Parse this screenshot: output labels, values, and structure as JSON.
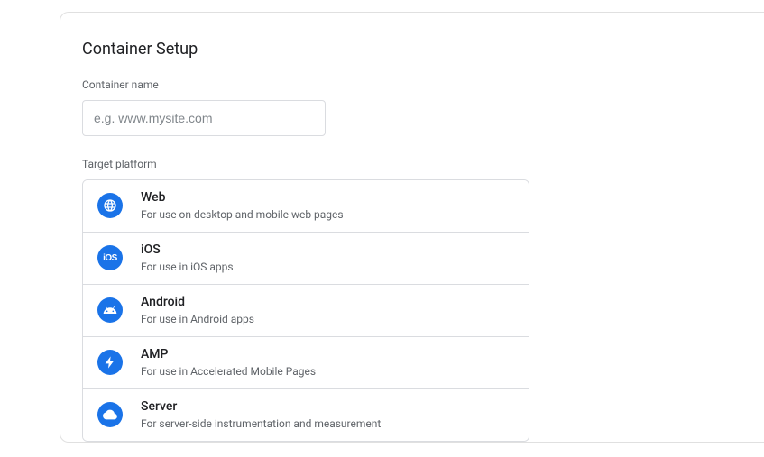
{
  "title": "Container Setup",
  "containerName": {
    "label": "Container name",
    "placeholder": "e.g. www.mysite.com",
    "value": ""
  },
  "targetPlatform": {
    "label": "Target platform",
    "options": [
      {
        "id": "web",
        "title": "Web",
        "desc": "For use on desktop and mobile web pages",
        "icon": "globe-icon"
      },
      {
        "id": "ios",
        "title": "iOS",
        "desc": "For use in iOS apps",
        "icon": "ios-icon"
      },
      {
        "id": "android",
        "title": "Android",
        "desc": "For use in Android apps",
        "icon": "android-icon"
      },
      {
        "id": "amp",
        "title": "AMP",
        "desc": "For use in Accelerated Mobile Pages",
        "icon": "amp-icon"
      },
      {
        "id": "server",
        "title": "Server",
        "desc": "For server-side instrumentation and measurement",
        "icon": "cloud-icon"
      }
    ]
  }
}
